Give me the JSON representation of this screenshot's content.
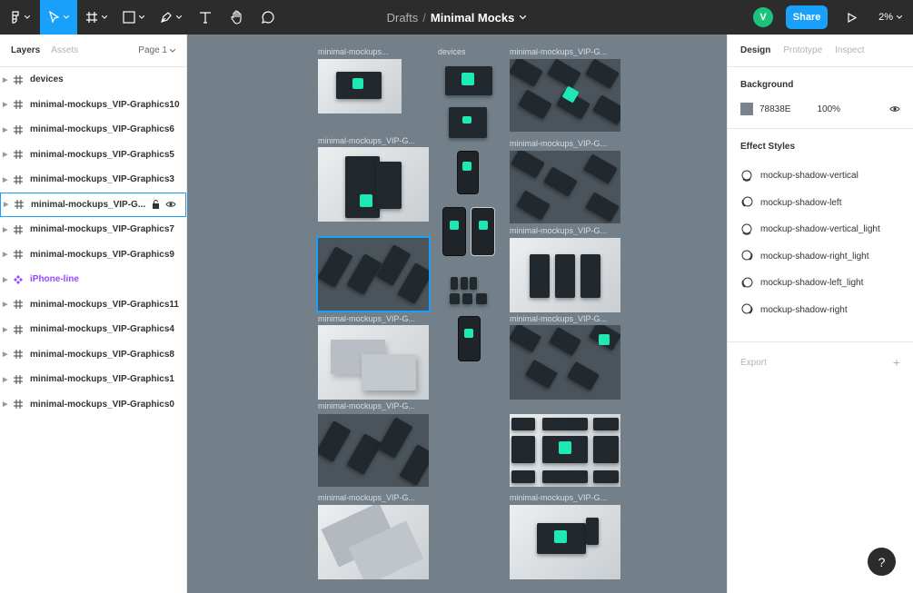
{
  "toolbar": {
    "breadcrumb": "Drafts",
    "separator": "/",
    "file_name": "Minimal Mocks",
    "avatar_initial": "V",
    "share_label": "Share",
    "zoom": "2%"
  },
  "left_panel": {
    "tabs": [
      "Layers",
      "Assets"
    ],
    "page": "Page 1",
    "layers": [
      {
        "name": "devices"
      },
      {
        "name": "minimal-mockups_VIP-Graphics10"
      },
      {
        "name": "minimal-mockups_VIP-Graphics6"
      },
      {
        "name": "minimal-mockups_VIP-Graphics5"
      },
      {
        "name": "minimal-mockups_VIP-Graphics3"
      },
      {
        "name": "minimal-mockups_VIP-G..."
      },
      {
        "name": "minimal-mockups_VIP-Graphics7"
      },
      {
        "name": "minimal-mockups_VIP-Graphics9"
      },
      {
        "name": "iPhone-line"
      },
      {
        "name": "minimal-mockups_VIP-Graphics11"
      },
      {
        "name": "minimal-mockups_VIP-Graphics4"
      },
      {
        "name": "minimal-mockups_VIP-Graphics8"
      },
      {
        "name": "minimal-mockups_VIP-Graphics1"
      },
      {
        "name": "minimal-mockups_VIP-Graphics0"
      }
    ]
  },
  "canvas": {
    "bg_color": "#78838E",
    "labels": {
      "c1": [
        "minimal-mockups...",
        "minimal-mockups_VIP-G...",
        "minimal-mockups_VIP-G...",
        "minimal-mockups_VIP-G...",
        "minimal-mockups_VIP-G..."
      ],
      "devices": "devices",
      "c3": [
        "minimal-mockups_VIP-G...",
        "minimal-mockups_VIP-G...",
        "minimal-mockups_VIP-G...",
        "minimal-mockups_VIP-G...",
        "minimal-mockups_VIP-G..."
      ]
    }
  },
  "right_panel": {
    "tabs": [
      "Design",
      "Prototype",
      "Inspect"
    ],
    "background_title": "Background",
    "bg_hex": "78838E",
    "bg_opacity": "100%",
    "effect_title": "Effect Styles",
    "effects": [
      "mockup-shadow-vertical",
      "mockup-shadow-left",
      "mockup-shadow-vertical_light",
      "mockup-shadow-right_light",
      "mockup-shadow-left_light",
      "mockup-shadow-right"
    ],
    "export_title": "Export"
  },
  "help_label": "?"
}
